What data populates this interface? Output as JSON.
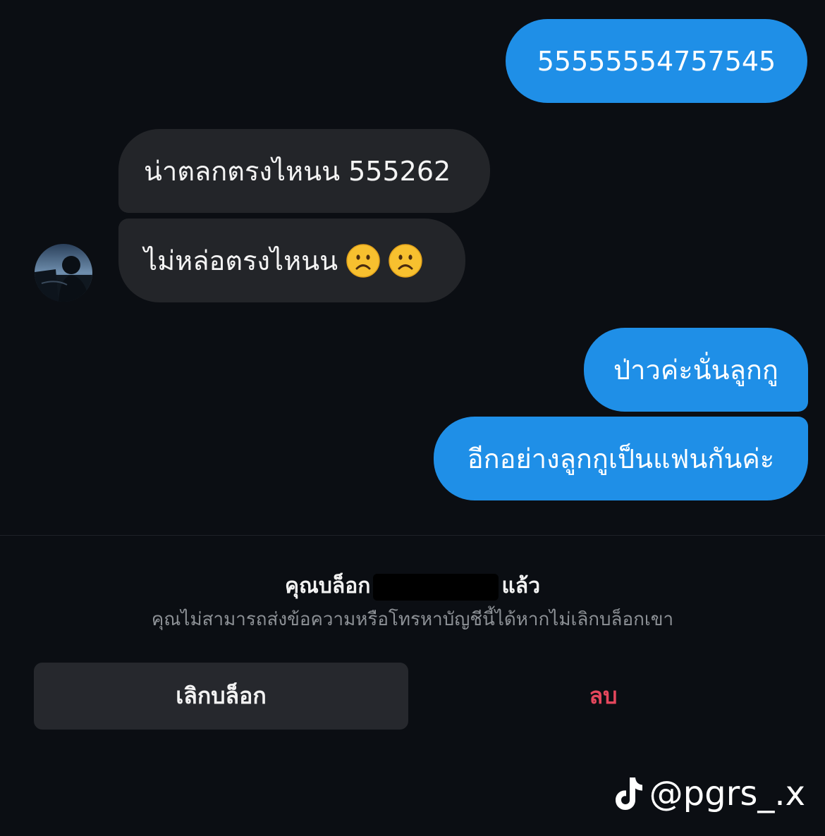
{
  "messages": [
    {
      "from": "me",
      "text": "55555554757545"
    },
    {
      "from": "them",
      "text": "น่าตลกตรงไหนน 555262"
    },
    {
      "from": "them",
      "text": "ไม่หล่อตรงไหนน",
      "emoji": [
        "frowning-face-emoji",
        "frowning-face-emoji"
      ]
    },
    {
      "from": "me",
      "text": "ป่าวค่ะนั่นลูกกู"
    },
    {
      "from": "me",
      "text": "อีกอย่างลูกกูเป็นแฟนกันค่ะ"
    }
  ],
  "block_notice": {
    "title_prefix": "คุณบล็อก",
    "title_suffix": "แล้ว",
    "subtitle": "คุณไม่สามารถส่งข้อความหรือโทรหาบัญชีนี้ได้หากไม่เลิกบล็อกเขา"
  },
  "actions": {
    "unblock_label": "เลิกบล็อก",
    "delete_label": "ลบ"
  },
  "watermark": {
    "icon": "tiktok-icon",
    "handle": "@pgrs_.x"
  },
  "colors": {
    "background": "#0b0e13",
    "sent_bubble": "#1f8fe7",
    "received_bubble": "#232529",
    "delete_text": "#e5475d"
  }
}
